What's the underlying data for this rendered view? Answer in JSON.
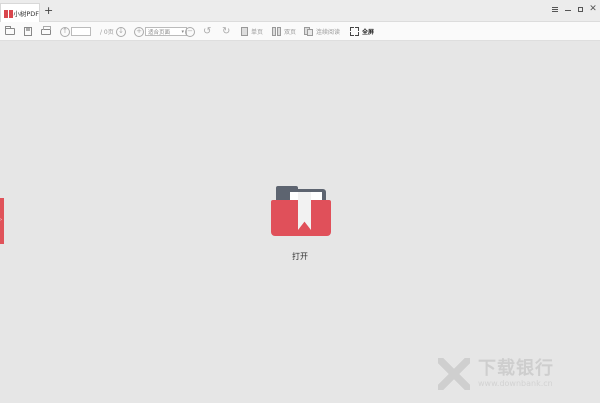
{
  "titlebar": {
    "tab_label": "小树PDF",
    "new_tab": "+",
    "controls": [
      "menu-icon",
      "minimize-icon",
      "maximize-icon",
      "close-icon"
    ],
    "close_glyph": "✕"
  },
  "toolbar": {
    "page_input_value": "",
    "page_total": "/ 0页",
    "zoom_value": "适合页面",
    "zoom_in": "+",
    "zoom_out": "−",
    "prev": "↑",
    "next": "↓",
    "rotate_left": "↺",
    "rotate_right": "↻",
    "single_page": "单页",
    "double_page": "双页",
    "continuous": "连续阅读",
    "fullscreen": "全屏"
  },
  "sidebar_handle": "›",
  "main": {
    "open_label": "打开"
  },
  "watermark": {
    "text_cn": "下载银行",
    "text_en": "www.downbank.cn"
  },
  "colors": {
    "accent": "#e0535a",
    "folder_dark": "#5d6470",
    "background": "#e6e6e6"
  }
}
